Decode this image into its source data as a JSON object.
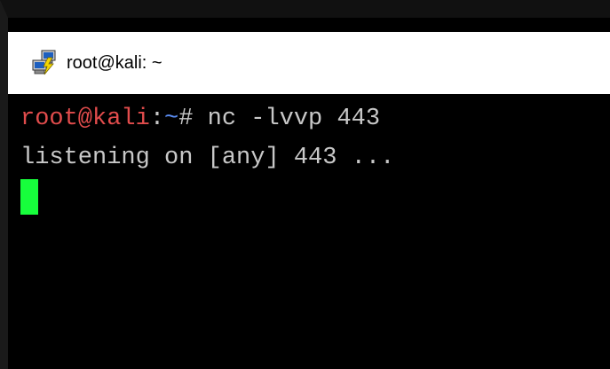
{
  "window": {
    "title": "root@kali: ~"
  },
  "terminal": {
    "prompt": {
      "user_host": "root@kali",
      "separator": ":",
      "path": "~",
      "symbol": "# "
    },
    "command": "nc -lvvp 443",
    "output": [
      "listening on [any] 443 ..."
    ],
    "colors": {
      "background": "#000000",
      "text": "#c8c8c8",
      "user_host": "#e14c4c",
      "path": "#5b8ef5",
      "cursor": "#17ff3c"
    }
  }
}
